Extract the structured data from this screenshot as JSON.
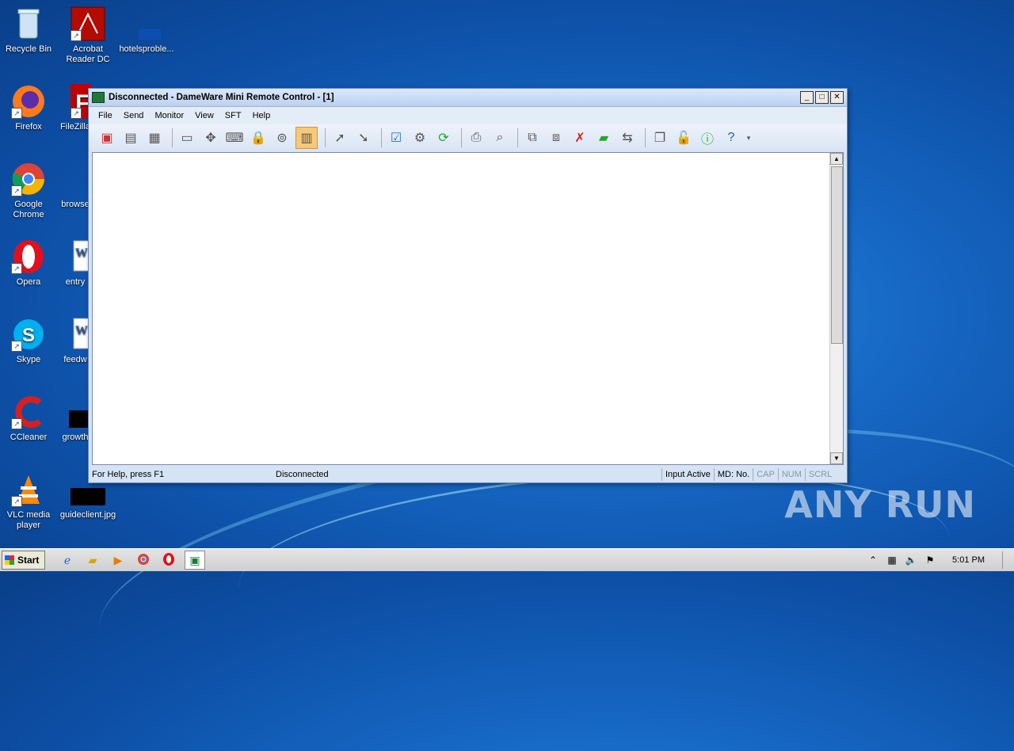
{
  "desktop": {
    "icons": [
      {
        "label": "Recycle Bin",
        "icon": "recycle-bin-icon"
      },
      {
        "label": "Acrobat Reader DC",
        "icon": "acrobat-icon"
      },
      {
        "label": "hotelsproble...",
        "icon": "file-icon"
      },
      {
        "label": "Firefox",
        "icon": "firefox-icon"
      },
      {
        "label": "FileZilla",
        "icon": "filezilla-icon"
      },
      {
        "label": "Google Chrome",
        "icon": "chrome-icon"
      },
      {
        "label": "browse",
        "icon": "file-icon"
      },
      {
        "label": "Opera",
        "icon": "opera-icon"
      },
      {
        "label": "entry",
        "icon": "word-icon"
      },
      {
        "label": "Skype",
        "icon": "skype-icon"
      },
      {
        "label": "feedw",
        "icon": "word-icon"
      },
      {
        "label": "CCleaner",
        "icon": "ccleaner-icon"
      },
      {
        "label": "growth",
        "icon": "file-icon"
      },
      {
        "label": "VLC media player",
        "icon": "vlc-icon"
      },
      {
        "label": "guideclient.jpg",
        "icon": "image-icon"
      }
    ],
    "watermark": "ANY RUN"
  },
  "window": {
    "title": "Disconnected - DameWare Mini Remote Control - [1]",
    "menu": [
      "File",
      "Send",
      "Monitor",
      "View",
      "SFT",
      "Help"
    ],
    "status": {
      "help": "For Help, press F1",
      "connection": "Disconnected",
      "input": "Input Active",
      "md": "MD: No.",
      "cap": "CAP",
      "num": "NUM",
      "scrl": "SCRL"
    }
  },
  "taskbar": {
    "start": "Start",
    "clock": "5:01 PM"
  }
}
